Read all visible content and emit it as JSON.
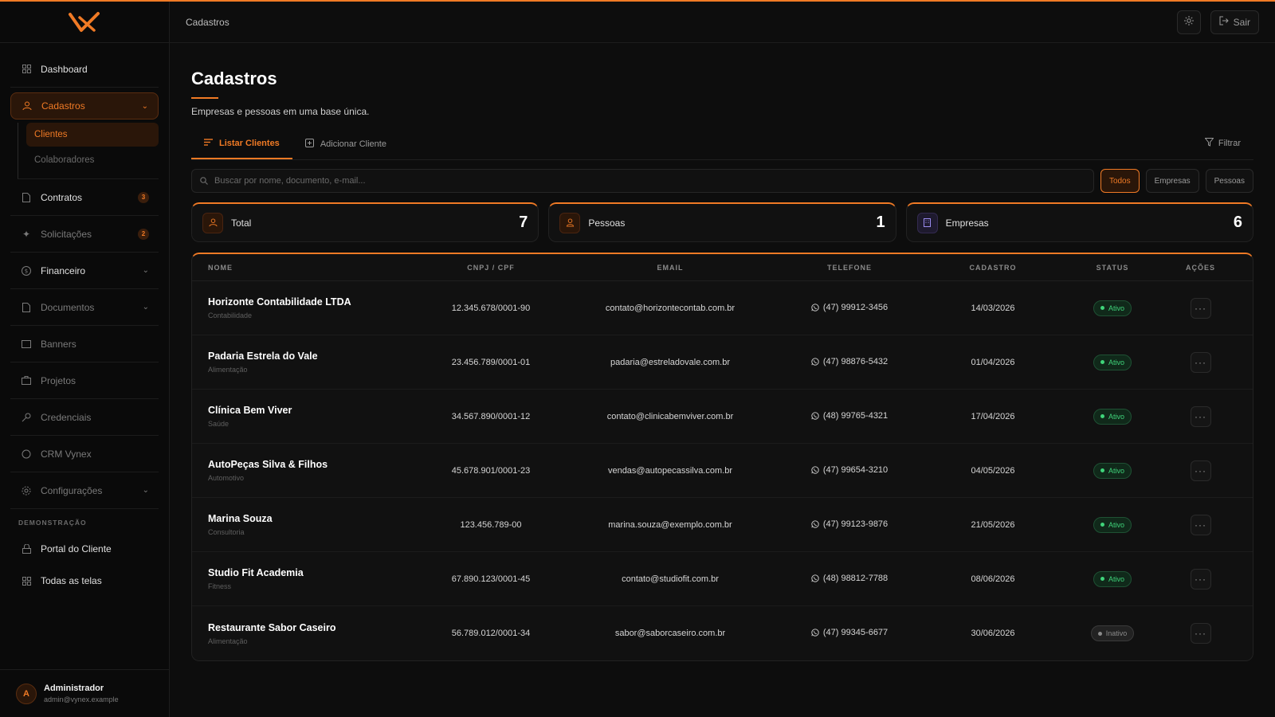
{
  "header": {
    "breadcrumb": "Cadastros",
    "logout_label": "Sair"
  },
  "sidebar": {
    "items": [
      {
        "label": "Dashboard"
      },
      {
        "label": "Cadastros",
        "subitems": [
          "Clientes",
          "Colaboradores"
        ]
      },
      {
        "label": "Contratos",
        "badge": "3"
      },
      {
        "label": "Solicitações",
        "badge": "2"
      },
      {
        "label": "Financeiro"
      },
      {
        "label": "Documentos"
      },
      {
        "label": "Banners"
      },
      {
        "label": "Projetos"
      },
      {
        "label": "Credenciais"
      },
      {
        "label": "CRM Vynex"
      },
      {
        "label": "Configurações"
      }
    ],
    "section_label": "DEMONSTRAÇÃO",
    "demo_items": [
      "Portal do Cliente",
      "Todas as telas"
    ],
    "user": {
      "initial": "A",
      "name": "Administrador",
      "email": "admin@vynex.example"
    }
  },
  "page": {
    "title": "Cadastros",
    "subtitle": "Empresas e pessoas em uma base única.",
    "tabs": [
      "Listar Clientes",
      "Adicionar Cliente"
    ],
    "filter_label": "Filtrar",
    "search_placeholder": "Buscar por nome, documento, e-mail...",
    "segments": [
      "Todos",
      "Empresas",
      "Pessoas"
    ],
    "stats": [
      {
        "label": "Total",
        "value": "7"
      },
      {
        "label": "Pessoas",
        "value": "1"
      },
      {
        "label": "Empresas",
        "value": "6"
      }
    ]
  },
  "table": {
    "headers": [
      "NOME",
      "CNPJ / CPF",
      "EMAIL",
      "TELEFONE",
      "CADASTRO",
      "STATUS",
      "AÇÕES"
    ],
    "rows": [
      {
        "name": "Horizonte Contabilidade LTDA",
        "category": "Contabilidade",
        "doc": "12.345.678/0001-90",
        "email": "contato@horizontecontab.com.br",
        "phone": "(47) 99912-3456",
        "date": "14/03/2026",
        "status": "Ativo"
      },
      {
        "name": "Padaria Estrela do Vale",
        "category": "Alimentação",
        "doc": "23.456.789/0001-01",
        "email": "padaria@estreladovale.com.br",
        "phone": "(47) 98876-5432",
        "date": "01/04/2026",
        "status": "Ativo"
      },
      {
        "name": "Clínica Bem Viver",
        "category": "Saúde",
        "doc": "34.567.890/0001-12",
        "email": "contato@clinicabemviver.com.br",
        "phone": "(48) 99765-4321",
        "date": "17/04/2026",
        "status": "Ativo"
      },
      {
        "name": "AutoPeças Silva & Filhos",
        "category": "Automotivo",
        "doc": "45.678.901/0001-23",
        "email": "vendas@autopecassilva.com.br",
        "phone": "(47) 99654-3210",
        "date": "04/05/2026",
        "status": "Ativo"
      },
      {
        "name": "Marina Souza",
        "category": "Consultoria",
        "doc": "123.456.789-00",
        "email": "marina.souza@exemplo.com.br",
        "phone": "(47) 99123-9876",
        "date": "21/05/2026",
        "status": "Ativo"
      },
      {
        "name": "Studio Fit Academia",
        "category": "Fitness",
        "doc": "67.890.123/0001-45",
        "email": "contato@studiofit.com.br",
        "phone": "(48) 98812-7788",
        "date": "08/06/2026",
        "status": "Ativo"
      },
      {
        "name": "Restaurante Sabor Caseiro",
        "category": "Alimentação",
        "doc": "56.789.012/0001-34",
        "email": "sabor@saborcaseiro.com.br",
        "phone": "(47) 99345-6677",
        "date": "30/06/2026",
        "status": "Inativo"
      }
    ],
    "actions_glyph": "···"
  }
}
